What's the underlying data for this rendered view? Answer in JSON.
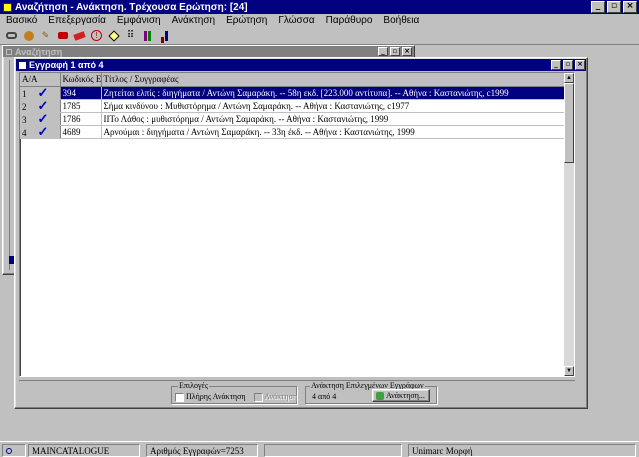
{
  "app": {
    "title": "Αναζήτηση - Ανάκτηση. Τρέχουσα Ερώτηση: [24]",
    "menu": [
      "Βασικό",
      "Επεξεργασία",
      "Εμφάνιση",
      "Ανάκτηση",
      "Ερώτηση",
      "Γλώσσα",
      "Παράθυρο",
      "Βοήθεια"
    ],
    "toolbar_icons": [
      "binoculars-icon",
      "refresh-icon",
      "pencil-icon",
      "print-icon",
      "eraser-icon",
      "info-icon",
      "diamond-icon",
      "grid-icon",
      "books-icon",
      "chart-icon"
    ]
  },
  "search_window": {
    "title": "Αναζήτηση"
  },
  "results_window": {
    "title": "Εγγραφή 1 από 4",
    "columns": [
      "Α/Α",
      "Κωδικός Εγγ",
      "Τίτλος / Συγγραφέας"
    ],
    "rows": [
      {
        "n": "1",
        "code": "394",
        "title": "Ζητείται ελπίς : διηγήματα / Αντώνη Σαμαράκη. -- 58η εκδ. [223.000 αντίτυπα]. -- Αθήνα : Καστανιώτης, c1999",
        "selected": true
      },
      {
        "n": "2",
        "code": "1785",
        "title": "Σήμα κινδύνου : Μυθιστόρημα / Αντώνη Σαμαράκη. -- Αθήνα : Καστανιώτης, c1977",
        "selected": false
      },
      {
        "n": "3",
        "code": "1786",
        "title": "ΙΙΤο Λάθος : μυθιστόρημα / Αντώνη Σαμαράκη. -- Αθήνα : Καστανιώτης, 1999",
        "selected": false
      },
      {
        "n": "4",
        "code": "4689",
        "title": "Αρνούμαι : διηγήματα / Αντώνη Σαμαράκη. -- 33η έκδ. -- Αθήνα : Καστανιώτης, 1999",
        "selected": false
      }
    ],
    "options_group": {
      "label": "Επιλογές",
      "full_search": "Πλήρης Ανάκτηση",
      "disabled_option": "Ανάκτηση"
    },
    "retrieve_group": {
      "label": "Ανάκτηση Επιλεγμένων Εγγράφων",
      "count": "4 από 4",
      "button": "Ανάκτηση..."
    }
  },
  "statusbar": {
    "db": "MAINCATALOGUE",
    "records": "Αριθμός Εγγραφών=7253",
    "format": "Unimarc Μορφή"
  }
}
